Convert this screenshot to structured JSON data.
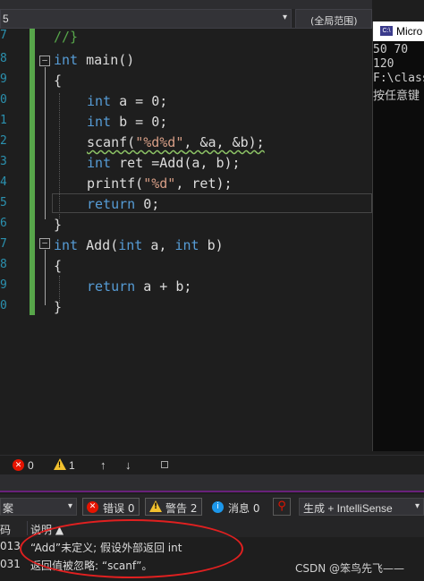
{
  "editor": {
    "scope_left_text": "5",
    "scope_right_text": "(全局范围)",
    "line_numbers": [
      "7",
      "8",
      "9",
      "0",
      "1",
      "2",
      "3",
      "4",
      "5",
      "6",
      "7",
      "8",
      "9",
      "0"
    ],
    "code_lines": [
      {
        "text": "//}"
      },
      {
        "text": "int main()"
      },
      {
        "text": "{"
      },
      {
        "text": "int a = 0;"
      },
      {
        "text": "int b = 0;"
      },
      {
        "text": "scanf(\"%d%d\", &a, &b);"
      },
      {
        "text": "int ret =Add(a, b);"
      },
      {
        "text": "printf(\"%d\", ret);"
      },
      {
        "text": "return 0;"
      },
      {
        "text": "}"
      },
      {
        "text": "int Add(int a, int b)"
      },
      {
        "text": "{"
      },
      {
        "text": "return a + b;"
      },
      {
        "text": "}"
      }
    ]
  },
  "console": {
    "title": "Micro",
    "icon_text": "C:\\",
    "lines": [
      "50 70",
      "120",
      "F:\\class",
      "按任意键"
    ]
  },
  "status": {
    "errors": "0",
    "warnings": "1"
  },
  "error_list": {
    "scope": "案",
    "errors_button": "错误 0",
    "warnings_button": "警告 2",
    "messages_button": "消息 0",
    "build_filter": "生成 + IntelliSense",
    "col_code": "码",
    "col_desc": "说明 ▲",
    "rows": [
      {
        "code": "013",
        "desc": "“Add”未定义; 假设外部返回 int"
      },
      {
        "code": "031",
        "desc": "返回值被忽略: “scanf”。"
      }
    ]
  },
  "watermark": "CSDN @笨鸟先飞——",
  "colors": {
    "keyword": "#569cd6",
    "string": "#d69d85",
    "comment": "#57a64a",
    "change_bar": "#57a64a",
    "annotation": "#e02020"
  }
}
